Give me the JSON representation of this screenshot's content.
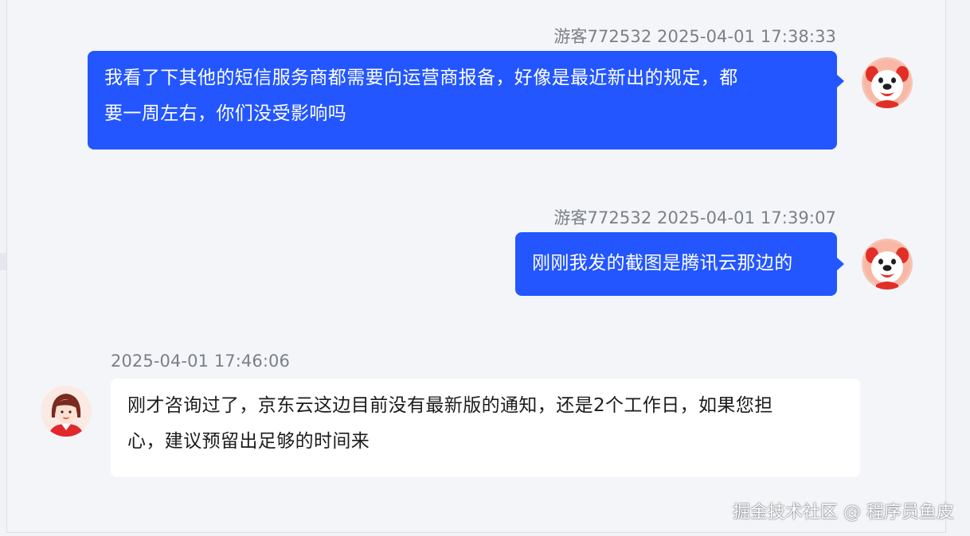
{
  "colors": {
    "outgoing_bubble": "#2356fe",
    "incoming_bubble": "#ffffff",
    "meta_text": "#7b7f87",
    "background": "#f3f5f9"
  },
  "messages": [
    {
      "direction": "outgoing",
      "sender": "游客772532",
      "timestamp": "2025-04-01 17:38:33",
      "header": "游客772532 2025-04-01 17:38:33",
      "lines": [
        "我看了下其他的短信服务商都需要向运营商报备，好像是最近新出的规定，都",
        "要一周左右，你们没受影响吗"
      ],
      "avatar_icon": "mascot-dog-icon"
    },
    {
      "direction": "outgoing",
      "sender": "游客772532",
      "timestamp": "2025-04-01 17:39:07",
      "header": "游客772532 2025-04-01 17:39:07",
      "lines": [
        "刚刚我发的截图是腾讯云那边的"
      ],
      "avatar_icon": "mascot-dog-icon"
    },
    {
      "direction": "incoming",
      "sender": "",
      "timestamp": "2025-04-01 17:46:06",
      "header": "2025-04-01 17:46:06",
      "lines": [
        "刚才咨询过了，京东云这边目前没有最新版的通知，还是2个工作日，如果您担",
        "心，建议预留出足够的时间来"
      ],
      "avatar_icon": "agent-woman-icon"
    }
  ],
  "watermark": "掘金技术社区 @ 程序员鱼皮"
}
